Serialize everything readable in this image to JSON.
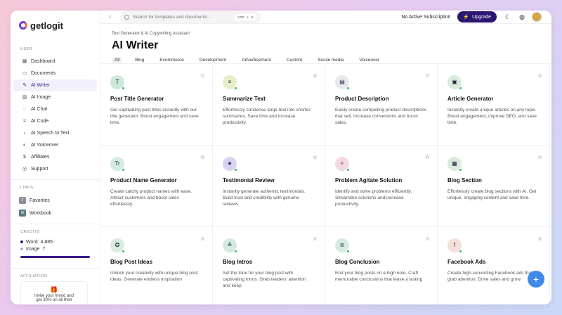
{
  "app": {
    "name": "getlogit"
  },
  "sidebar": {
    "user_label": "USER",
    "items": [
      {
        "label": "Dashboard",
        "icon": "grid-icon"
      },
      {
        "label": "Documents",
        "icon": "document-icon"
      },
      {
        "label": "AI Writer",
        "icon": "writer-icon"
      },
      {
        "label": "AI Image",
        "icon": "image-icon"
      },
      {
        "label": "AI Chat",
        "icon": "chat-icon"
      },
      {
        "label": "AI Code",
        "icon": "code-icon"
      },
      {
        "label": "AI Speech to Text",
        "icon": "mic-icon"
      },
      {
        "label": "AI Voiceover",
        "icon": "speaker-icon"
      },
      {
        "label": "Affiliates",
        "icon": "dollar-icon"
      },
      {
        "label": "Support",
        "icon": "support-icon"
      }
    ],
    "links_label": "LINKS",
    "links": [
      {
        "label": "Favorites",
        "badge": "F"
      },
      {
        "label": "Workbook",
        "badge": "W"
      }
    ],
    "credits_label": "CREDITS",
    "credits": {
      "word_label": "Word",
      "word_value": "4,885",
      "image_label": "Image",
      "image_value": "7"
    },
    "affiliation_label": "AFFILIATION",
    "promo_line1": "Invite your friend and",
    "promo_line2": "get 30% on all their"
  },
  "topbar": {
    "search_placeholder": "Search for templates and documents...",
    "shortcut": "cmd + K",
    "subscription_status": "No Active Subscription",
    "upgrade_label": "Upgrade"
  },
  "header": {
    "breadcrumb": "Text Generator & AI Copywriting Assistant",
    "title": "AI Writer",
    "tabs": [
      "All",
      "Blog",
      "Ecommerce",
      "Development",
      "Advertisement",
      "Custom",
      "Social media",
      "Voiceover"
    ]
  },
  "templates": [
    {
      "title": "Post Title Generator",
      "desc": "Get captivating post titles instantly with our title generator. Boost engagement and save time.",
      "icon": "T",
      "color": "#cfe8d8"
    },
    {
      "title": "Summarize Text",
      "desc": "Effortlessly condense large text into shorter summaries. Save time and increase productivity.",
      "icon": "≡",
      "color": "#e6f0c8"
    },
    {
      "title": "Product Description",
      "desc": "Easily create compelling product descriptions that sell. Increase conversions and boost sales.",
      "icon": "▤",
      "color": "#e8e8ec"
    },
    {
      "title": "Article Generator",
      "desc": "Instantly create unique articles on any topic. Boost engagement, improve SEO, and save time.",
      "icon": "▣",
      "color": "#d9ecdc"
    },
    {
      "title": "Product Name Generator",
      "desc": "Create catchy product names with ease. Attract customers and boost sales effortlessly.",
      "icon": "Tr",
      "color": "#d4ece0"
    },
    {
      "title": "Testimonial Review",
      "desc": "Instantly generate authentic testimonials. Build trust and credibility with genuine reviews.",
      "icon": "★",
      "color": "#d8d4f0"
    },
    {
      "title": "Problem Agitate Solution",
      "desc": "Identify and solve problems efficiently. Streamline solutions and increase productivity.",
      "icon": "✧",
      "color": "#f2d8e0"
    },
    {
      "title": "Blog Section",
      "desc": "Effortlessly create blog sections with AI. Get unique, engaging content and save time.",
      "icon": "▦",
      "color": "#d9ecdc"
    },
    {
      "title": "Blog Post Ideas",
      "desc": "Unlock your creativity with unique blog post ideas. Generate endless inspiration",
      "icon": "✪",
      "color": "#d9ecdc"
    },
    {
      "title": "Blog Intros",
      "desc": "Set the tone for your blog post with captivating intros. Grab readers' attention and keep",
      "icon": "≜",
      "color": "#d4ece0"
    },
    {
      "title": "Blog Conclusion",
      "desc": "End your blog posts on a high note. Craft memorable conclusions that leave a lasting",
      "icon": "≣",
      "color": "#d4ece0"
    },
    {
      "title": "Facebook Ads",
      "desc": "Create high-converting Facebook ads that grab attention. Drive sales and grow",
      "icon": "f",
      "color": "#f4e0d8"
    }
  ]
}
